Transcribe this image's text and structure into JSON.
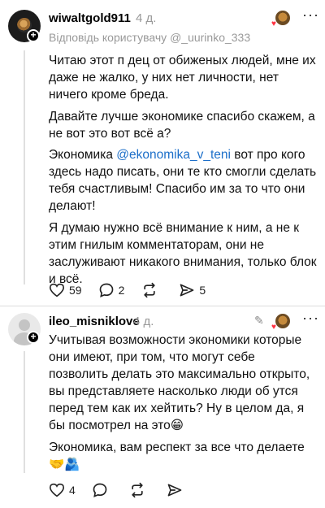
{
  "comment1": {
    "username": "wiwaltgold911",
    "time": "4 д.",
    "reply_to": "Відповідь користувачу @_uurinko_333",
    "paragraphs": [
      "Читаю этот п     дец от обиженых людей, мне их даже не жалко, у них нет личности, нет ничего кроме бреда.",
      "Давайте лучше экономике спасибо скажем, а не вот это вот всё а?",
      "Я думаю нужно всё внимание к ним, а не к этим гнилым комментаторам, они не заслуживают никакого внимания, только блок и всё."
    ],
    "mention_para": {
      "before": "Экономика ",
      "mention": "@ekonomika_v_teni",
      "after": " вот про кого здесь надо писать, они те кто смогли сделать тебя счастливым! Спасибо им за то что они делают!"
    },
    "likes": "59",
    "replies": "2",
    "shares": "5"
  },
  "comment2": {
    "username": "ileo_misniklove",
    "time": "4 д.",
    "paragraphs": [
      "Учитывая возможности экономики которые они имеют, при том, что могут себе позволить делать это максимально открыто, вы представляете насколько люди об      утся перед тем как их хейтить? Ну в целом да, я бы посмотрел на это😁",
      "Экономика, вам респект за все что делаете 🤝🫂"
    ],
    "likes": "4"
  }
}
